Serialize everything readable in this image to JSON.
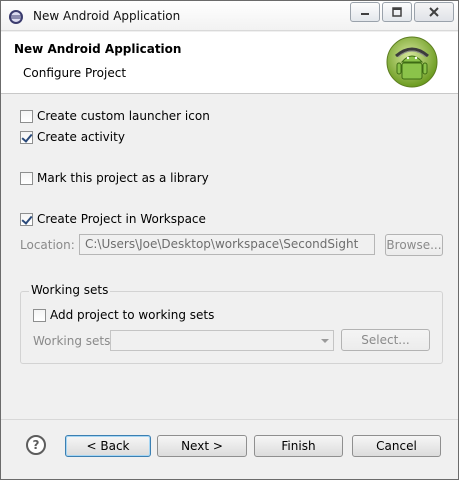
{
  "window": {
    "title": "New Android Application",
    "controls": [
      "minimize-icon",
      "maximize-icon",
      "close-icon"
    ]
  },
  "header": {
    "title": "New Android Application",
    "subtitle": "Configure Project",
    "logo": "android-icon"
  },
  "options": {
    "custom_launcher_icon": {
      "label": "Create custom launcher icon",
      "checked": false
    },
    "create_activity": {
      "label": "Create activity",
      "checked": true
    },
    "mark_library": {
      "label": "Mark this project as a library",
      "checked": false
    },
    "create_in_workspace": {
      "label": "Create Project in Workspace",
      "checked": true
    }
  },
  "location": {
    "label": "Location:",
    "value": "C:\\Users\\Joe\\Desktop\\workspace\\SecondSight",
    "browse_label": "Browse..."
  },
  "working_sets": {
    "group_title": "Working sets",
    "add_label": "Add project to working sets",
    "add_checked": false,
    "sets_label": "Working sets:",
    "sets_value": "",
    "select_label": "Select..."
  },
  "buttons": {
    "back": "< Back",
    "next": "Next >",
    "finish": "Finish",
    "cancel": "Cancel",
    "help": "?"
  }
}
